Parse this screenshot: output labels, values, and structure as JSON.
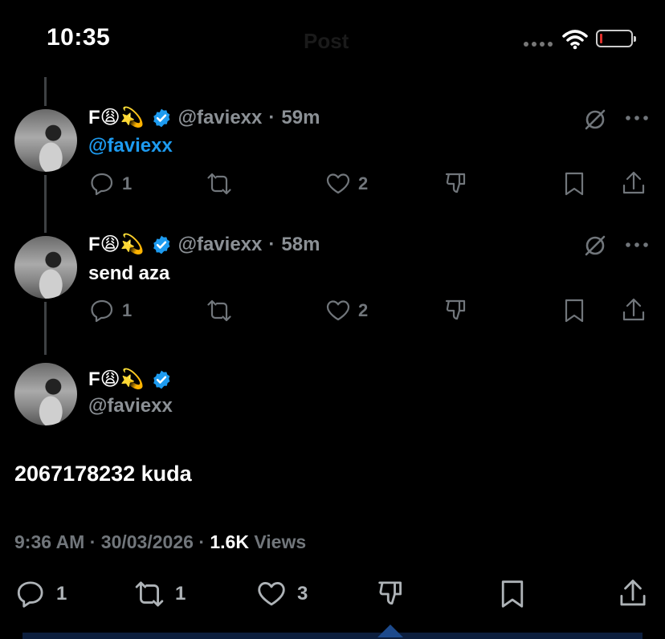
{
  "status_bar": {
    "time": "10:35",
    "title": "Post"
  },
  "replies": [
    {
      "display_name": "F😩💫",
      "handle": "@faviexx",
      "sep": "·",
      "time": "59m",
      "text": "@faviexx",
      "reply_count": "1",
      "repost_count": "",
      "like_count": "2"
    },
    {
      "display_name": "F😩💫",
      "handle": "@faviexx",
      "sep": "·",
      "time": "58m",
      "text": "send aza",
      "reply_count": "1",
      "repost_count": "",
      "like_count": "2"
    }
  ],
  "main_post": {
    "display_name": "F😩💫",
    "handle": "@faviexx",
    "text": "2067178232 kuda",
    "time": "9:36 AM",
    "sep1": "·",
    "date": "30/03/2026",
    "sep2": "·",
    "views_count": "1.6K",
    "views_label": "Views",
    "reply_count": "1",
    "repost_count": "1",
    "like_count": "3"
  },
  "icons": {
    "reply": "reply-icon",
    "repost": "repost-icon",
    "like": "heart-icon",
    "dislike": "dislike-icon",
    "bookmark": "bookmark-icon",
    "share": "share-icon",
    "more": "more-icon",
    "grok": "grok-icon",
    "verified": "verified-badge-icon"
  },
  "colors": {
    "background": "#000000",
    "accent": "#1d9bf0",
    "muted": "#71767b"
  }
}
